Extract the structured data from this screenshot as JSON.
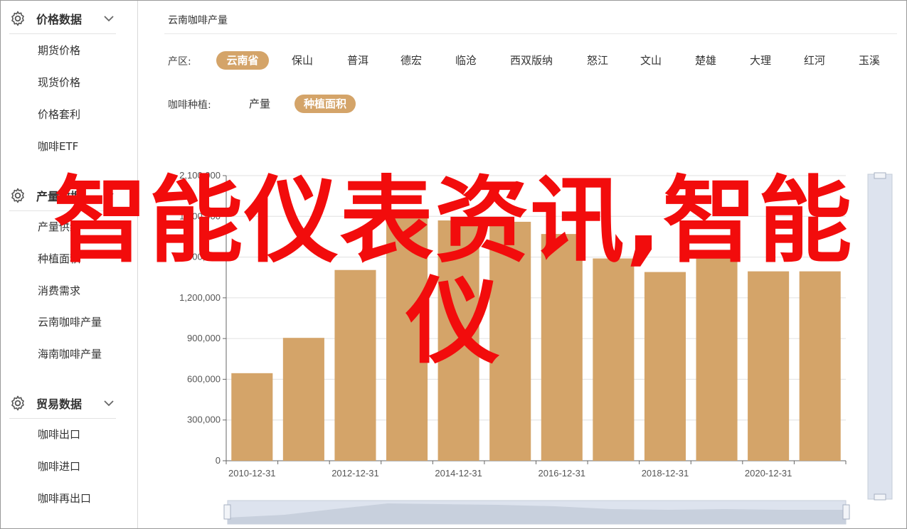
{
  "sidebar": {
    "groups": [
      {
        "title": "价格数据",
        "icon": "gear-icon",
        "items": [
          "期货价格",
          "现货价格",
          "价格套利",
          "咖啡ETF"
        ]
      },
      {
        "title": "产量数据",
        "icon": "gear-icon",
        "items": [
          "产量供给",
          "种植面积",
          "消费需求",
          "云南咖啡产量",
          "海南咖啡产量"
        ]
      },
      {
        "title": "贸易数据",
        "icon": "gear-icon",
        "items": [
          "咖啡出口",
          "咖啡进口",
          "咖啡再出口"
        ]
      }
    ]
  },
  "main": {
    "title": "云南咖啡产量",
    "region_label": "产区:",
    "regions": [
      "云南省",
      "保山",
      "普洱",
      "德宏",
      "临沧",
      "西双版纳",
      "怒江",
      "文山",
      "楚雄",
      "大理",
      "红河",
      "玉溪"
    ],
    "region_selected": "云南省",
    "type_label": "咖啡种植:",
    "types": [
      "产量",
      "种植面积"
    ],
    "type_selected": "种植面积"
  },
  "overlay_text": [
    "智能仪表资讯,智能",
    "仪"
  ],
  "colors": {
    "accent": "#d4a469",
    "bar": "#d4a469",
    "overlay": "#f20c0c"
  },
  "chart_data": {
    "type": "bar",
    "x": [
      "2010-12-31",
      "2011-12-31",
      "2012-12-31",
      "2013-12-31",
      "2014-12-31",
      "2015-12-31",
      "2016-12-31",
      "2017-12-31",
      "2018-12-31",
      "2019-12-31",
      "2020-12-31",
      "2021-12-31"
    ],
    "x_tick_labels": [
      "2010-12-31",
      "2012-12-31",
      "2014-12-31",
      "2016-12-31",
      "2018-12-31",
      "2020-12-31"
    ],
    "values": [
      645000,
      905000,
      1405000,
      1850000,
      1770000,
      1760000,
      1670000,
      1490000,
      1390000,
      1490000,
      1395000,
      1395000
    ],
    "yticks": [
      "0",
      "300,000",
      "600,000",
      "900,000",
      "1,200,000",
      "1,500,000",
      "1,800,000",
      "2,100,000"
    ],
    "ylim": [
      0,
      2100000
    ],
    "grid": true,
    "title": "",
    "xlabel": "",
    "ylabel": ""
  }
}
